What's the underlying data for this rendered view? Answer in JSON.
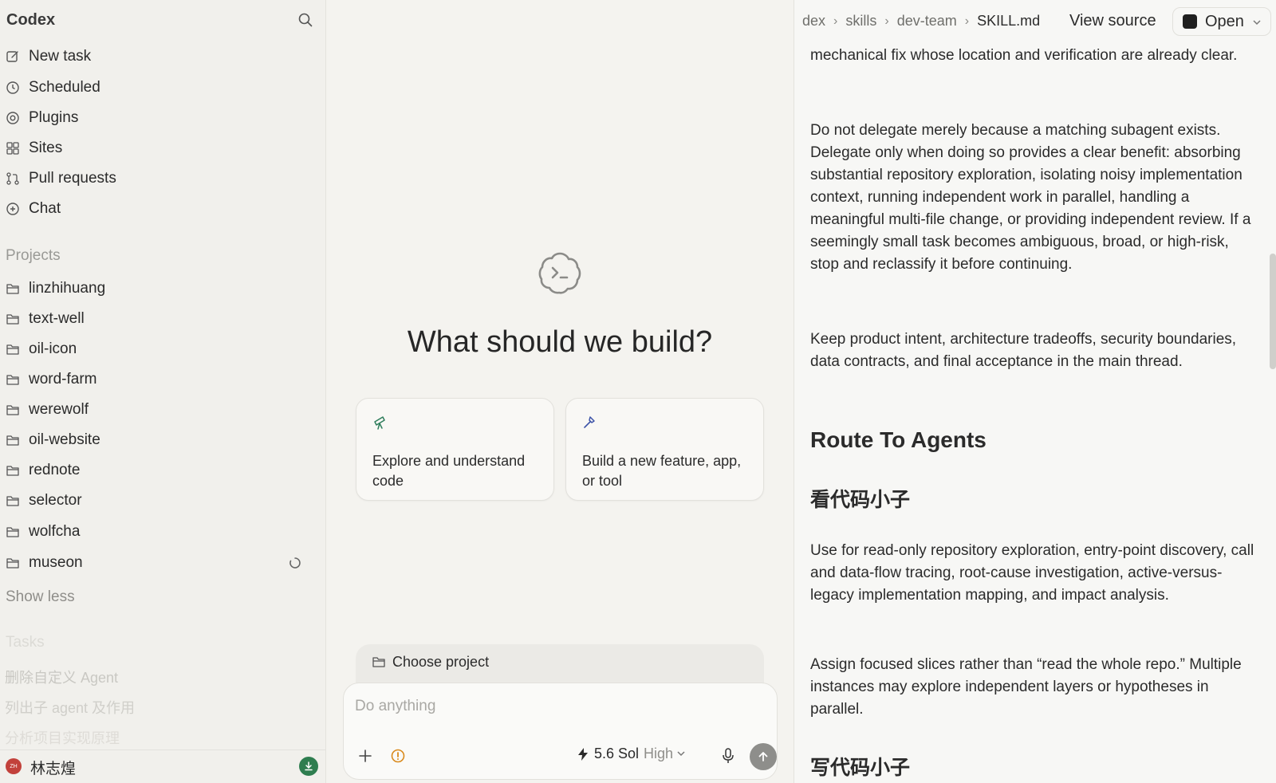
{
  "sidebar": {
    "app_title": "Codex",
    "nav": [
      {
        "label": "New task",
        "icon": "edit-icon"
      },
      {
        "label": "Scheduled",
        "icon": "clock-icon"
      },
      {
        "label": "Plugins",
        "icon": "at-icon"
      },
      {
        "label": "Sites",
        "icon": "grid-icon"
      },
      {
        "label": "Pull requests",
        "icon": "git-pr-icon"
      },
      {
        "label": "Chat",
        "icon": "chat-plus-icon"
      }
    ],
    "projects_label": "Projects",
    "projects": [
      "linzhihuang",
      "text-well",
      "oil-icon",
      "word-farm",
      "werewolf",
      "oil-website",
      "rednote",
      "selector",
      "wolfcha",
      "museon"
    ],
    "show_less": "Show less",
    "tasks_label": "Tasks",
    "tasks": [
      "删除自定义 Agent",
      "列出子 agent 及作用",
      "分析项目实现原理"
    ],
    "user": {
      "avatar_text": "ZH",
      "name": "林志煌"
    }
  },
  "main": {
    "hero_title": "What should we build?",
    "cards": [
      {
        "label": "Explore and understand code",
        "icon": "telescope-icon"
      },
      {
        "label": "Build a new feature, app, or tool",
        "icon": "hammer-icon"
      }
    ],
    "project_picker": "Choose project",
    "composer": {
      "placeholder": "Do anything",
      "model": "5.6 Sol",
      "effort": "High"
    }
  },
  "doc": {
    "breadcrumbs": [
      "dex",
      "skills",
      "dev-team",
      "SKILL.md"
    ],
    "view_source": "View source",
    "open_label": "Open",
    "paragraphs": [
      "mechanical fix whose location and verification are already clear.",
      "Do not delegate merely because a matching subagent exists. Delegate only when doing so provides a clear benefit: absorbing substantial repository exploration, isolating noisy implementation context, running independent work in parallel, handling a meaningful multi-file change, or providing independent review. If a seemingly small task becomes ambiguous, broad, or high-risk, stop and reclassify it before continuing.",
      "Keep product intent, architecture tradeoffs, security boundaries, data contracts, and final acceptance in the main thread."
    ],
    "heading_route": "Route To Agents",
    "heading_reader": "看代码小子",
    "reader_paragraphs": [
      "Use for read-only repository exploration, entry-point discovery, call and data-flow tracing, root-cause investigation, active-versus-legacy implementation mapping, and impact analysis.",
      "Assign focused slices rather than “read the whole repo.” Multiple instances may explore independent layers or hypotheses in parallel."
    ],
    "heading_writer": "写代码小子"
  }
}
